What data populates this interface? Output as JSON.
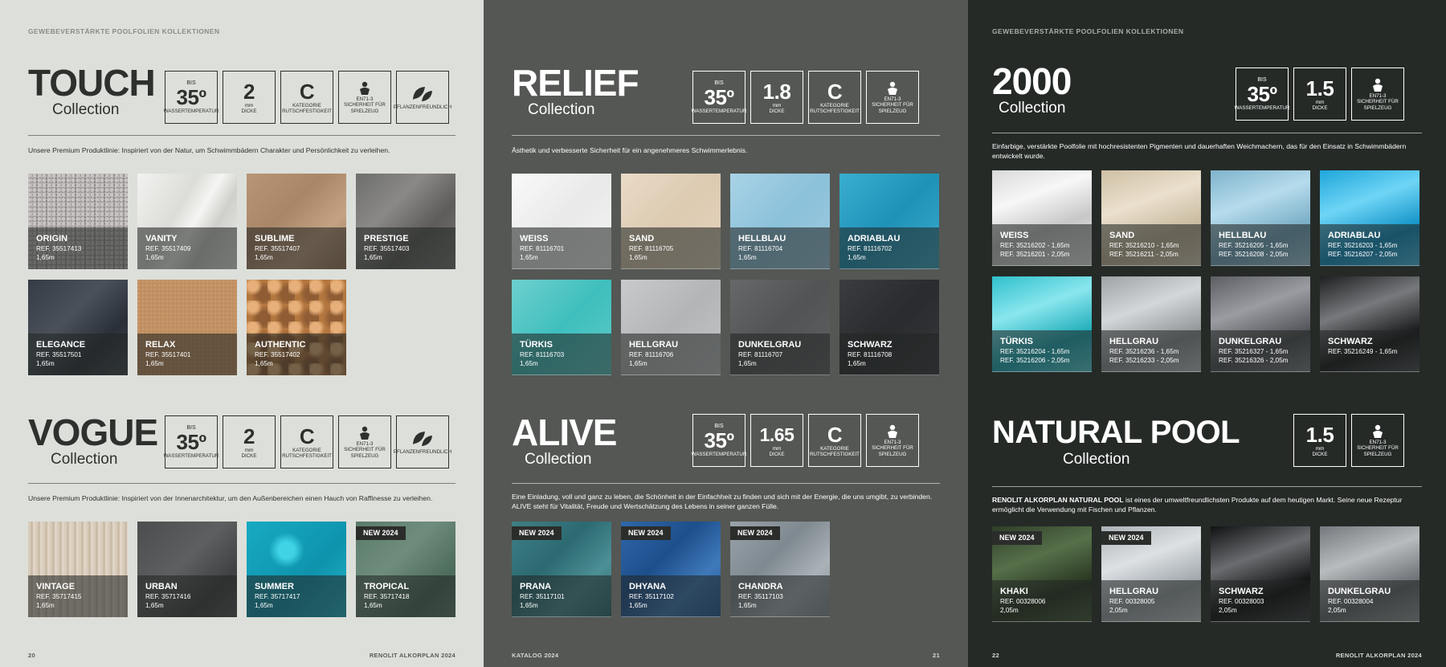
{
  "header_text": "GEWEBEVERSTÄRKTE POOLFOLIEN KOLLEKTIONEN",
  "collection_word": "Collection",
  "new_label": "NEW 2024",
  "badge_text": {
    "bis": "BIS",
    "temp": "35º",
    "temp_label": "WASSERTEMPERATUR",
    "mm": "mm",
    "dicke": "DICKE",
    "kategorie": "KATEGORIE",
    "c": "C",
    "rutsch": "RUTSCHFESTIGKEIT",
    "en": "EN71-3",
    "spielzeug": "SICHERHEIT FÜR SPIELZEUG",
    "pflanzen": "PFLANZENFREUNDLICH"
  },
  "page1": {
    "footer_num": "20",
    "footer_text": "RENOLIT ALKORPLAN 2024",
    "touch": {
      "title": "TOUCH",
      "thickness": "2",
      "desc": "Unsere Premium Produktlinie: Inspiriert von der Natur, um Schwimmbädern Charakter und Persönlichkeit zu verleihen.",
      "tiles": [
        {
          "name": "ORIGIN",
          "ref": "REF. 35517413",
          "size": "1,65m"
        },
        {
          "name": "VANITY",
          "ref": "REF. 35517409",
          "size": "1,65m"
        },
        {
          "name": "SUBLIME",
          "ref": "REF. 35517407",
          "size": "1,65m"
        },
        {
          "name": "PRESTIGE",
          "ref": "REF. 35517403",
          "size": "1,65m"
        },
        {
          "name": "ELEGANCE",
          "ref": "REF. 35517501",
          "size": "1,65m"
        },
        {
          "name": "RELAX",
          "ref": "REF. 35517401",
          "size": "1,65m"
        },
        {
          "name": "AUTHENTIC",
          "ref": "REF. 35517402",
          "size": "1,65m"
        }
      ]
    },
    "vogue": {
      "title": "VOGUE",
      "thickness": "2",
      "desc": "Unsere Premium Produktlinie: Inspiriert von der Innenarchitektur, um den Außenbereichen einen Hauch von Raffinesse zu verleihen.",
      "tiles": [
        {
          "name": "VINTAGE",
          "ref": "REF. 35717415",
          "size": "1,65m"
        },
        {
          "name": "URBAN",
          "ref": "REF. 35717416",
          "size": "1,65m"
        },
        {
          "name": "SUMMER",
          "ref": "REF. 35717417",
          "size": "1,65m"
        },
        {
          "name": "TROPICAL",
          "ref": "REF. 35717418",
          "size": "1,65m"
        }
      ]
    }
  },
  "page2": {
    "footer_left": "KATALOG 2024",
    "footer_num": "21",
    "relief": {
      "title": "RELIEF",
      "thickness": "1.8",
      "desc": "Ästhetik und verbesserte Sicherheit für ein angenehmeres Schwimmerlebnis.",
      "tiles": [
        {
          "name": "WEISS",
          "ref": "REF. 81116701",
          "size": "1,65m"
        },
        {
          "name": "SAND",
          "ref": "REF. 81116705",
          "size": "1,65m"
        },
        {
          "name": "HELLBLAU",
          "ref": "REF. 81116704",
          "size": "1,65m"
        },
        {
          "name": "ADRIABLAU",
          "ref": "REF. 81116702",
          "size": "1,65m"
        },
        {
          "name": "TÜRKIS",
          "ref": "REF. 81116703",
          "size": "1,65m"
        },
        {
          "name": "HELLGRAU",
          "ref": "REF. 81116706",
          "size": "1,65m"
        },
        {
          "name": "DUNKELGRAU",
          "ref": "REF. 81116707",
          "size": "1,65m"
        },
        {
          "name": "SCHWARZ",
          "ref": "REF. 81116708",
          "size": "1,65m"
        }
      ]
    },
    "alive": {
      "title": "ALIVE",
      "thickness": "1.65",
      "desc": "Eine Einladung, voll und ganz zu leben, die Schönheit in der Einfachheit zu finden und sich mit der Energie, die uns umgibt, zu verbinden. ALIVE steht für Vitalität, Freude und Wertschätzung des Lebens in seiner ganzen Fülle.",
      "tiles": [
        {
          "name": "PRANA",
          "ref": "REF. 35117101",
          "size": "1,65m"
        },
        {
          "name": "DHYANA",
          "ref": "REF. 35117102",
          "size": "1,65m"
        },
        {
          "name": "CHANDRA",
          "ref": "REF. 35117103",
          "size": "1,65m"
        }
      ]
    }
  },
  "page3": {
    "footer_num": "22",
    "footer_text": "RENOLIT ALKORPLAN 2024",
    "c2000": {
      "title": "2000",
      "thickness": "1.5",
      "desc": "Einfarbige, verstärkte Poolfolie mit hochresistenten Pigmenten und dauerhaften Weichmachern, das für den Einsatz in Schwimmbädern entwickelt wurde.",
      "tiles": [
        {
          "name": "WEISS",
          "ref": "REF. 35216202 - 1,65m",
          "size": "REF. 35216201 - 2,05m"
        },
        {
          "name": "SAND",
          "ref": "REF. 35216210 - 1,65m",
          "size": "REF. 35216211 - 2,05m"
        },
        {
          "name": "HELLBLAU",
          "ref": "REF. 35216205 - 1,65m",
          "size": "REF. 35216208 - 2,05m"
        },
        {
          "name": "ADRIABLAU",
          "ref": "REF. 35216203 - 1,65m",
          "size": "REF. 35216207 - 2,05m"
        },
        {
          "name": "TÜRKIS",
          "ref": "REF. 35216204 - 1,65m",
          "size": "REF. 35216206 - 2,05m"
        },
        {
          "name": "HELLGRAU",
          "ref": "REF. 35216236 - 1,65m",
          "size": "REF. 35216233 - 2,05m"
        },
        {
          "name": "DUNKELGRAU",
          "ref": "REF. 35216327 - 1,65m",
          "size": "REF. 35216326 - 2,05m"
        },
        {
          "name": "SCHWARZ",
          "ref": "REF. 35216249 - 1,65m",
          "size": ""
        }
      ]
    },
    "natural": {
      "title": "NATURAL POOL",
      "thickness": "1.5",
      "desc_bold": "RENOLIT ALKORPLAN NATURAL POOL",
      "desc": " ist eines der umweltfreundlichsten Produkte auf dem heutigen Markt. Seine neue Rezeptur ermöglicht die Verwendung mit Fischen und Pflanzen.",
      "tiles": [
        {
          "name": "KHAKI",
          "ref": "REF. 00328006",
          "size": "2,05m"
        },
        {
          "name": "HELLGRAU",
          "ref": "REF. 00328005",
          "size": "2,05m"
        },
        {
          "name": "SCHWARZ",
          "ref": "REF. 00328003",
          "size": "2,05m"
        },
        {
          "name": "DUNKELGRAU",
          "ref": "REF. 00328004",
          "size": "2,05m"
        }
      ]
    }
  }
}
